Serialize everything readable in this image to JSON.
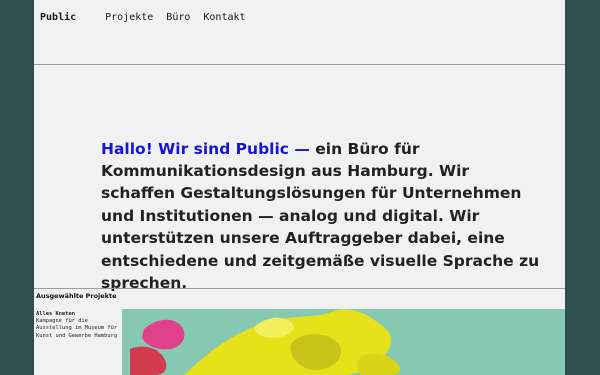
{
  "nav": {
    "brand": "Public",
    "links": [
      "Projekte",
      "Büro",
      "Kontakt"
    ]
  },
  "hero": {
    "accent": "Hallo! Wir sind Public —",
    "text": " ein Büro für Kommunikationsdesign aus Hamburg. Wir schaffen Gestaltungslösungen für Unternehmen und Institutionen — analog und digital. Wir unterstützen unsere Auftraggeber dabei, eine entschiedene und zeitgemäße visuelle Sprache zu sprechen."
  },
  "section": {
    "label": "Ausgewählte Projekte"
  },
  "project": {
    "title": "Alles Kneten",
    "description": "Kampagne für die Ausstellung im Museum für Kunst und Gewerbe Hamburg"
  },
  "colors": {
    "page_bg": "#2f4f4f",
    "frame_bg": "#f1f1f1",
    "accent": "#1515d6",
    "project_bg": "#86c8b1",
    "art_yellow": "#e6e21a",
    "art_pink": "#e0418a",
    "art_red": "#d23a4e"
  }
}
